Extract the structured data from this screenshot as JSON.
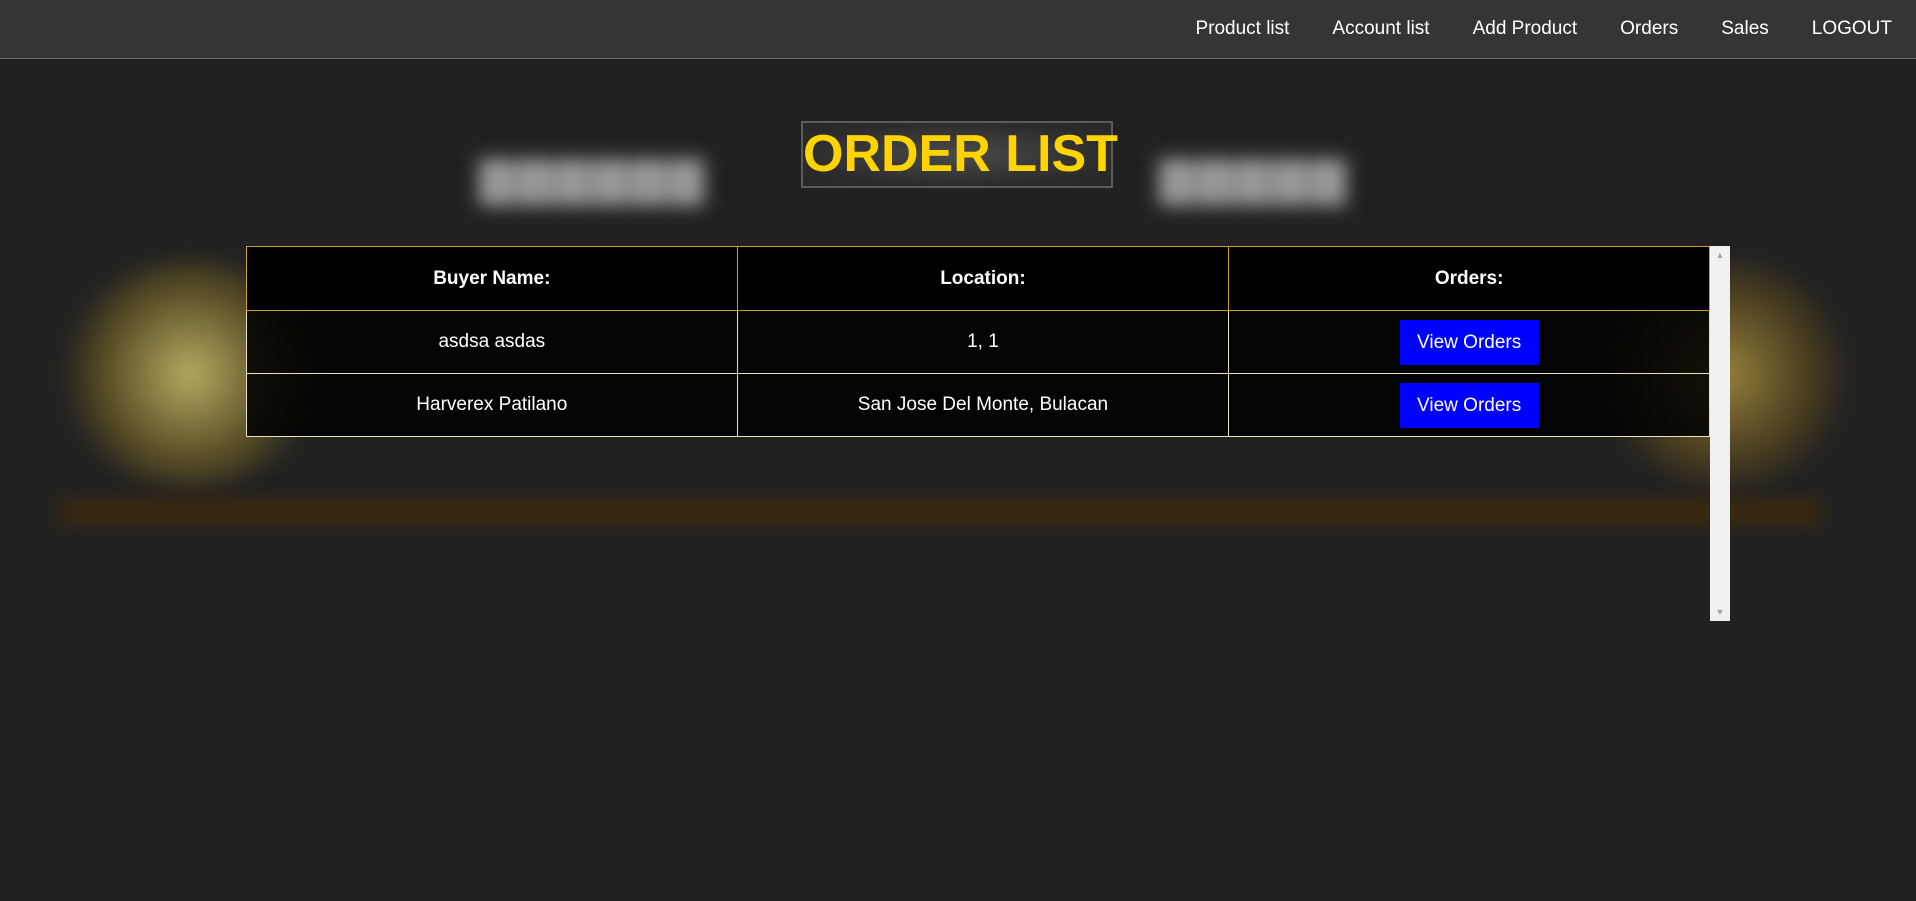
{
  "nav": {
    "items": [
      {
        "label": "Product list"
      },
      {
        "label": "Account list"
      },
      {
        "label": "Add Product"
      },
      {
        "label": "Orders"
      },
      {
        "label": "Sales"
      },
      {
        "label": "LOGOUT"
      }
    ]
  },
  "page": {
    "title": "ORDER LIST"
  },
  "table": {
    "columns": [
      "Buyer Name:",
      "Location:",
      "Orders:"
    ],
    "rows": [
      {
        "buyer": "asdsa asdas",
        "location": "1, 1",
        "action": "View Orders"
      },
      {
        "buyer": "Harverex Patilano",
        "location": "San Jose Del Monte, Bulacan",
        "action": "View Orders"
      }
    ]
  },
  "scrollbar": {
    "up_icon": "▲",
    "down_icon": "▼"
  },
  "colors": {
    "title": "#ffd400",
    "button": "#0000ff",
    "header_border": "#c9a227",
    "navbar": "#353535",
    "background": "#212121"
  }
}
